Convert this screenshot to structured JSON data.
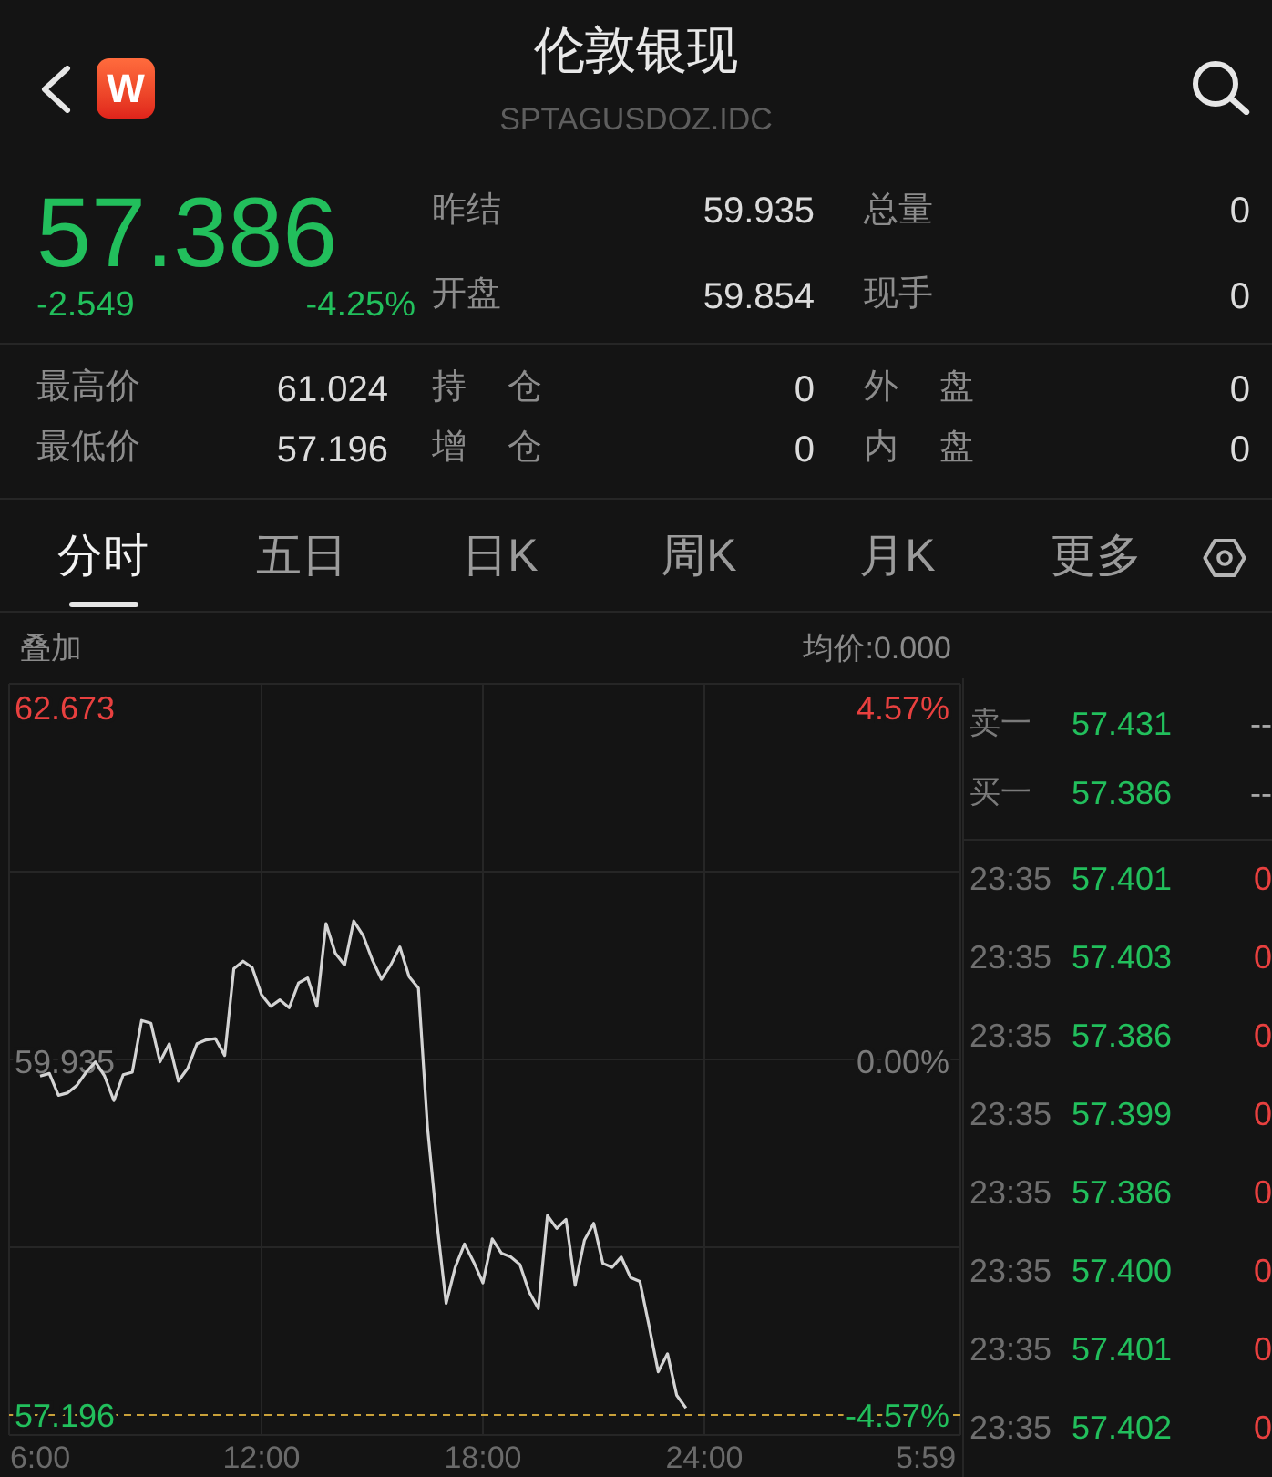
{
  "header": {
    "logo": "W",
    "title": "伦敦银现",
    "code": "SPTAGUSDOZ.IDC"
  },
  "quote": {
    "price": "57.386",
    "change": "-2.549",
    "change_pct": "-4.25%",
    "down": true,
    "rows": [
      [
        {
          "label": "昨结",
          "value": "59.935"
        },
        {
          "label": "总量",
          "value": "0"
        }
      ],
      [
        {
          "label": "开盘",
          "value": "59.854"
        },
        {
          "label": "现手",
          "value": "0"
        }
      ]
    ]
  },
  "stats": [
    [
      {
        "label": "最高价",
        "value": "61.024"
      },
      {
        "label": "持 仓",
        "value": "0"
      },
      {
        "label": "外 盘",
        "value": "0"
      }
    ],
    [
      {
        "label": "最低价",
        "value": "57.196"
      },
      {
        "label": "增 仓",
        "value": "0"
      },
      {
        "label": "内 盘",
        "value": "0"
      }
    ]
  ],
  "tabs": [
    {
      "label": "分时",
      "selected": true
    },
    {
      "label": "五日",
      "selected": false
    },
    {
      "label": "日K",
      "selected": false
    },
    {
      "label": "周K",
      "selected": false
    },
    {
      "label": "月K",
      "selected": false
    },
    {
      "label": "更多",
      "selected": false
    }
  ],
  "toolbar": {
    "overlay": "叠加",
    "avg_price": "均价:0.000"
  },
  "chart": {
    "chart_data": {
      "type": "line",
      "grid": true,
      "categories": [
        "6:00",
        null,
        null,
        null,
        null,
        null,
        null,
        null,
        null,
        null,
        null,
        null,
        null,
        null,
        null,
        null,
        null,
        null,
        null,
        null,
        null,
        null,
        null,
        null,
        "12:00",
        null,
        null,
        null,
        null,
        null,
        null,
        null,
        null,
        null,
        null,
        null,
        null,
        null,
        null,
        null,
        null,
        null,
        null,
        null,
        null,
        null,
        null,
        null,
        "18:00",
        null,
        null,
        null,
        null,
        null,
        null,
        null,
        null,
        null,
        null,
        null,
        null,
        null,
        null,
        null,
        null,
        null,
        null,
        null,
        null,
        null,
        null,
        null,
        "24:00",
        null,
        null,
        null,
        null,
        null,
        null,
        null,
        null,
        null,
        null,
        null,
        null,
        null,
        null,
        null,
        null,
        null,
        null,
        null,
        null,
        null,
        null,
        null,
        "5:59"
      ],
      "values": [
        59.82,
        59.84,
        59.67,
        59.69,
        59.75,
        59.85,
        59.93,
        59.82,
        59.63,
        59.83,
        59.85,
        60.25,
        60.23,
        59.93,
        60.07,
        59.78,
        59.88,
        60.07,
        60.1,
        60.11,
        59.98,
        60.65,
        60.71,
        60.66,
        60.45,
        60.36,
        60.41,
        60.35,
        60.54,
        60.58,
        60.36,
        61.0,
        60.77,
        60.68,
        61.02,
        60.91,
        60.72,
        60.57,
        60.68,
        60.82,
        60.59,
        60.5,
        59.42,
        58.69,
        58.06,
        58.34,
        58.52,
        58.38,
        58.22,
        58.56,
        58.45,
        58.42,
        58.36,
        58.15,
        58.02,
        58.74,
        58.64,
        58.71,
        58.2,
        58.55,
        58.68,
        58.37,
        58.34,
        58.42,
        58.26,
        58.23,
        57.89,
        57.53,
        57.67,
        57.35,
        57.25,
        null,
        null,
        null,
        null,
        null,
        null,
        null,
        null,
        null,
        null,
        null,
        null,
        null,
        null,
        null,
        null,
        null,
        null,
        null,
        null,
        null,
        null,
        null,
        null,
        null,
        null
      ],
      "ylim": [
        57.196,
        62.673
      ],
      "yticks": [
        {
          "value": 57.196,
          "label": "57.196"
        },
        {
          "value": 59.935,
          "label": "59.935"
        },
        {
          "value": 62.673,
          "label": "62.673"
        }
      ]
    },
    "percent_labels": [
      {
        "text": "4.57%",
        "color": "#e8403f"
      },
      {
        "text": "0.00%",
        "color": "#7a7a7a"
      },
      {
        "text": "-4.57%",
        "color": "#22bf5c"
      }
    ]
  },
  "order_book": [
    {
      "label": "卖一",
      "price": "57.431",
      "volume": "--"
    },
    {
      "label": "买一",
      "price": "57.386",
      "volume": "--"
    }
  ],
  "trades": [
    {
      "time": "23:35",
      "price": "57.401",
      "volume": "0"
    },
    {
      "time": "23:35",
      "price": "57.403",
      "volume": "0"
    },
    {
      "time": "23:35",
      "price": "57.386",
      "volume": "0"
    },
    {
      "time": "23:35",
      "price": "57.399",
      "volume": "0"
    },
    {
      "time": "23:35",
      "price": "57.386",
      "volume": "0"
    },
    {
      "time": "23:35",
      "price": "57.400",
      "volume": "0"
    },
    {
      "time": "23:35",
      "price": "57.401",
      "volume": "0"
    },
    {
      "time": "23:35",
      "price": "57.402",
      "volume": "0"
    }
  ]
}
